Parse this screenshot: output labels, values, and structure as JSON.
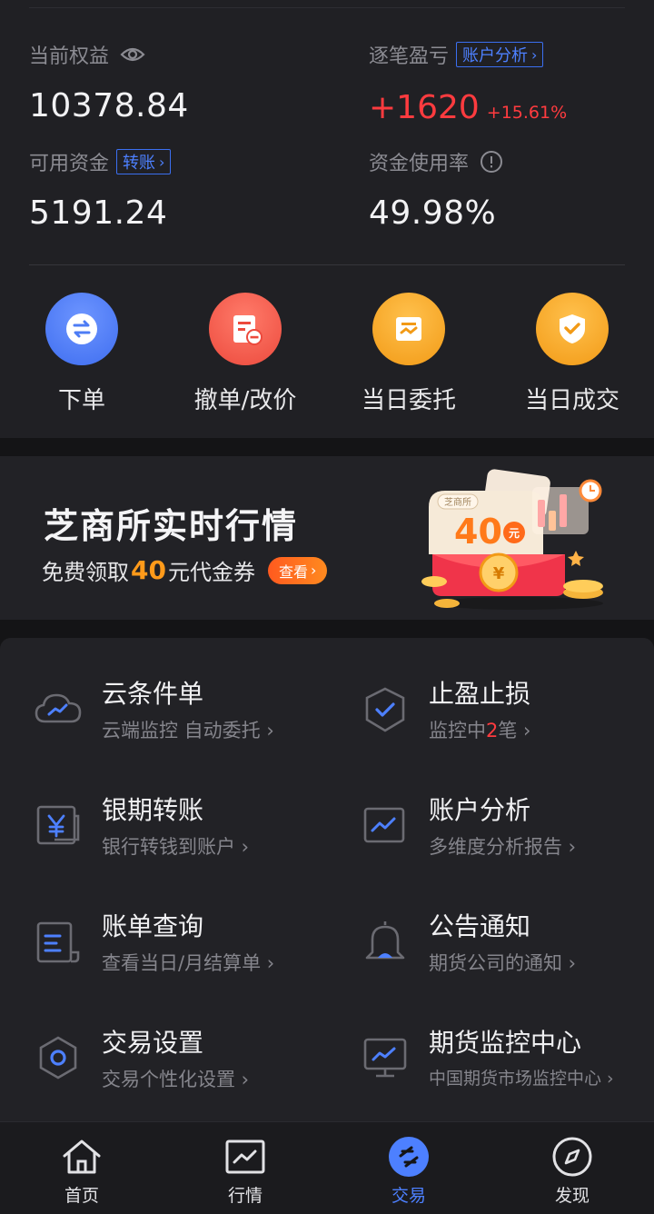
{
  "account": {
    "equity_label": "当前权益",
    "equity_value": "10378.84",
    "pnl_label": "逐笔盈亏",
    "pnl_analysis_btn": "账户分析",
    "pnl_value": "+1620",
    "pnl_pct": "+15.61%",
    "available_label": "可用资金",
    "transfer_btn": "转账",
    "available_value": "5191.24",
    "usage_label": "资金使用率",
    "usage_value": "49.98%"
  },
  "actions": [
    {
      "label": "下单",
      "icon": "exchange-icon",
      "color": "#4d7cf5"
    },
    {
      "label": "撤单/改价",
      "icon": "cancel-order-icon",
      "color": "#f25a4a"
    },
    {
      "label": "当日委托",
      "icon": "entrust-icon",
      "color": "#f5a623"
    },
    {
      "label": "当日成交",
      "icon": "deal-icon",
      "color": "#f5a623"
    }
  ],
  "banner": {
    "title": "芝商所实时行情",
    "sub_prefix": "免费领取",
    "sub_amount": "40",
    "sub_suffix": "元代金券",
    "button": "查看",
    "art_tag": "芝商所",
    "art_amount": "40",
    "art_unit": "元"
  },
  "features": [
    {
      "title": "云条件单",
      "sub": "云端监控 自动委托",
      "icon": "cloud-chart-icon"
    },
    {
      "title": "止盈止损",
      "sub_prefix": "监控中",
      "sub_count": "2",
      "sub_suffix": "笔",
      "icon": "shield-check-icon"
    },
    {
      "title": "银期转账",
      "sub": "银行转钱到账户",
      "icon": "yuan-icon"
    },
    {
      "title": "账户分析",
      "sub": "多维度分析报告",
      "icon": "chart-line-icon"
    },
    {
      "title": "账单查询",
      "sub": "查看当日/月结算单",
      "icon": "bill-icon"
    },
    {
      "title": "公告通知",
      "sub": "期货公司的通知",
      "icon": "bell-icon"
    },
    {
      "title": "交易设置",
      "sub": "交易个性化设置",
      "icon": "settings-hexagon-icon"
    },
    {
      "title": "期货监控中心",
      "sub": "中国期货市场监控中心",
      "icon": "monitor-icon"
    }
  ],
  "tabbar": [
    {
      "label": "首页",
      "icon": "home-icon"
    },
    {
      "label": "行情",
      "icon": "market-icon"
    },
    {
      "label": "交易",
      "icon": "trade-icon",
      "active": true
    },
    {
      "label": "发现",
      "icon": "compass-icon"
    }
  ],
  "colors": {
    "accent": "#4d80ff",
    "loss_red": "#ff3b3f",
    "banner_orange": "#ff9a1a"
  }
}
